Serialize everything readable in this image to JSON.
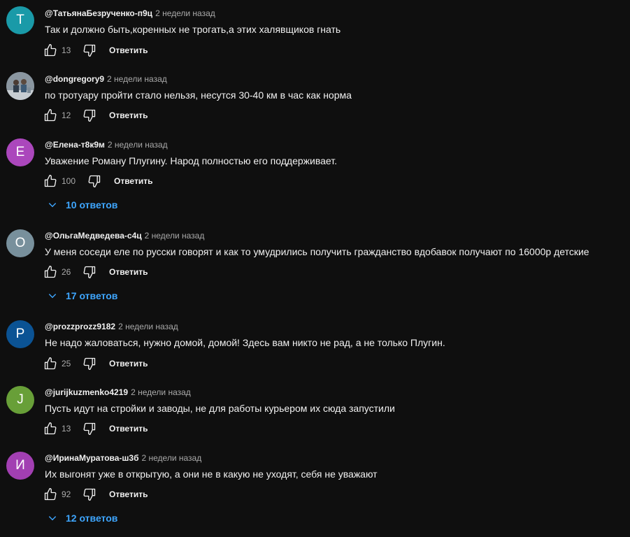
{
  "comments": [
    {
      "avatar_letter": "Т",
      "avatar_color": "#1a9aa8",
      "author": "@ТатьянаБезрученко-п9ц",
      "time": "2 недели назад",
      "text": "Так и должно быть,коренных не трогать,а этих халявщиков гнать",
      "likes": "13",
      "reply_label": "Ответить"
    },
    {
      "avatar_letter": "",
      "avatar_color": "#6b7a86",
      "author": "@dongregory9",
      "time": "2 недели назад",
      "text": "по тротуару  пройти стало нельзя, несутся 30-40 км в час как норма",
      "likes": "12",
      "reply_label": "Ответить"
    },
    {
      "avatar_letter": "Е",
      "avatar_color": "#ab47bc",
      "author": "@Елена-т8к9м",
      "time": "2 недели назад",
      "text": "Уважение Роману Плугину. Народ полностью его поддерживает.",
      "likes": "100",
      "reply_label": "Ответить",
      "replies": "10 ответов"
    },
    {
      "avatar_letter": "О",
      "avatar_color": "#78909c",
      "author": "@ОльгаМедведева-с4ц",
      "time": "2 недели назад",
      "text": "У меня соседи еле по русски говорят и как то умудрились получить гражданство вдобавок получают по 16000р детские",
      "likes": "26",
      "reply_label": "Ответить",
      "replies": "17 ответов"
    },
    {
      "avatar_letter": "P",
      "avatar_color": "#0b5394",
      "author": "@prozzprozz9182",
      "time": "2 недели назад",
      "text": "Не надо жаловаться, нужно домой, домой! Здесь вам никто не рад, а не только Плугин.",
      "likes": "25",
      "reply_label": "Ответить"
    },
    {
      "avatar_letter": "J",
      "avatar_color": "#689f38",
      "author": "@jurijkuzmenko4219",
      "time": "2 недели назад",
      "text": "Пусть идут на стройки и заводы, не для работы курьером их сюда запустили",
      "likes": "13",
      "reply_label": "Ответить"
    },
    {
      "avatar_letter": "И",
      "avatar_color": "#a23fb2",
      "author": "@ИринаМуратова-ш3б",
      "time": "2 недели назад",
      "text": "Их выгонят уже в открытую, а они не в какую не уходят, себя не уважают",
      "likes": "92",
      "reply_label": "Ответить",
      "replies": "12 ответов"
    }
  ],
  "icons": {
    "like": "thumb-up-icon",
    "dislike": "thumb-down-icon",
    "expand": "chevron-down-icon"
  }
}
